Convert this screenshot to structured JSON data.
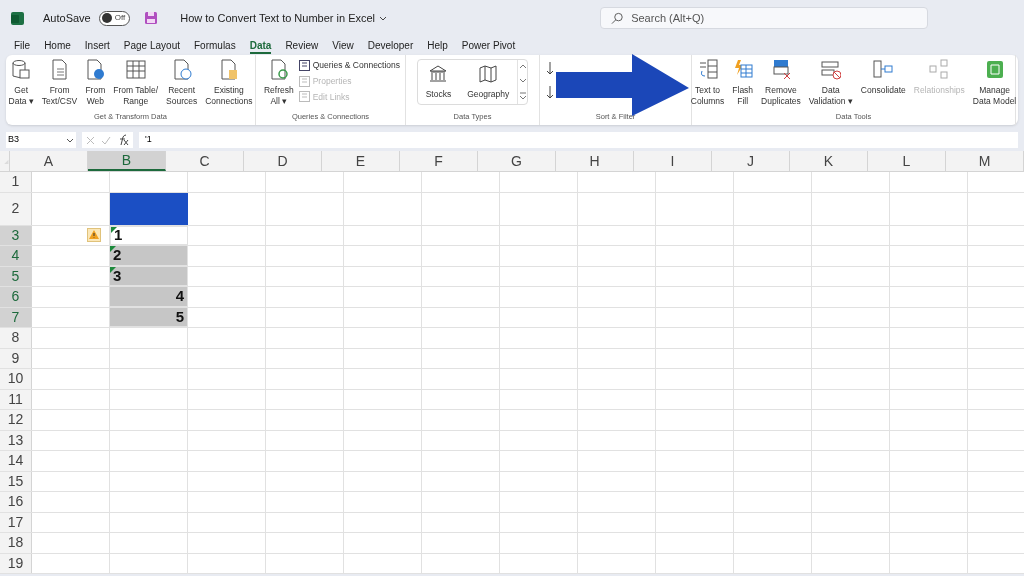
{
  "title_bar": {
    "autosave_label": "AutoSave",
    "autosave": {
      "on": false,
      "label": "Off"
    },
    "document_title": "How to Convert Text to Number in Excel",
    "search": {
      "placeholder": "Search (Alt+Q)"
    }
  },
  "tabs": [
    {
      "label": "File",
      "selected": false
    },
    {
      "label": "Home",
      "selected": false
    },
    {
      "label": "Insert",
      "selected": false
    },
    {
      "label": "Page Layout",
      "selected": false
    },
    {
      "label": "Formulas",
      "selected": false
    },
    {
      "label": "Data",
      "selected": true
    },
    {
      "label": "Review",
      "selected": false
    },
    {
      "label": "View",
      "selected": false
    },
    {
      "label": "Developer",
      "selected": false
    },
    {
      "label": "Help",
      "selected": false
    },
    {
      "label": "Power Pivot",
      "selected": false
    }
  ],
  "ribbon_groups": [
    {
      "label": "Get & Transform Data",
      "kind": "buttons",
      "buttons": [
        {
          "lines": [
            "Get",
            "Data ▾"
          ],
          "disabled": false
        },
        {
          "lines": [
            "From",
            "Text/CSV"
          ],
          "disabled": false
        },
        {
          "lines": [
            "From",
            "Web"
          ],
          "disabled": false
        },
        {
          "lines": [
            "From Table/",
            "Range"
          ],
          "disabled": false
        },
        {
          "lines": [
            "Recent",
            "Sources"
          ],
          "disabled": false
        },
        {
          "lines": [
            "Existing",
            "Connections"
          ],
          "disabled": false
        }
      ]
    },
    {
      "label": "Queries & Connections",
      "kind": "queries",
      "buttons": [
        {
          "lines": [
            "Refresh",
            "All ▾"
          ],
          "disabled": false
        }
      ],
      "small": [
        {
          "label": "Queries & Connections",
          "disabled": false
        },
        {
          "label": "Properties",
          "disabled": true
        },
        {
          "label": "Edit Links",
          "disabled": true
        }
      ]
    },
    {
      "label": "Data Types",
      "kind": "types",
      "buttons": [
        {
          "lines": [
            "Stocks"
          ]
        },
        {
          "lines": [
            "Geography"
          ]
        }
      ]
    },
    {
      "label": "Sort & Filter",
      "kind": "sort"
    },
    {
      "label": "Data Tools",
      "kind": "buttons",
      "buttons": [
        {
          "lines": [
            "Text to",
            "Columns"
          ],
          "disabled": false
        },
        {
          "lines": [
            "Flash",
            "Fill"
          ],
          "disabled": false
        },
        {
          "lines": [
            "Remove",
            "Duplicates"
          ],
          "disabled": false
        },
        {
          "lines": [
            "Data",
            "Validation ▾"
          ],
          "disabled": false
        },
        {
          "lines": [
            "Consolidate"
          ],
          "disabled": false
        },
        {
          "lines": [
            "Relationships"
          ],
          "disabled": true
        },
        {
          "lines": [
            "Manage",
            "Data Model"
          ],
          "disabled": false
        }
      ]
    }
  ],
  "formula_bar": {
    "name_box": "B3",
    "formula": "'1"
  },
  "columns": [
    {
      "label": "A",
      "selected": false
    },
    {
      "label": "B",
      "selected": true
    },
    {
      "label": "C",
      "selected": false
    },
    {
      "label": "D",
      "selected": false
    },
    {
      "label": "E",
      "selected": false
    },
    {
      "label": "F",
      "selected": false
    },
    {
      "label": "G",
      "selected": false
    },
    {
      "label": "H",
      "selected": false
    },
    {
      "label": "I",
      "selected": false
    },
    {
      "label": "J",
      "selected": false
    },
    {
      "label": "K",
      "selected": false
    },
    {
      "label": "L",
      "selected": false
    },
    {
      "label": "M",
      "selected": false
    }
  ],
  "rows": [
    {
      "header": "1",
      "selected": false
    },
    {
      "header": "2",
      "selected": false,
      "column_b": {
        "kind": "banner"
      }
    },
    {
      "header": "3",
      "selected": true,
      "warning": true,
      "column_b": {
        "kind": "text",
        "value": "1",
        "selected": true
      }
    },
    {
      "header": "4",
      "selected": true,
      "column_b": {
        "kind": "text",
        "value": "2",
        "selected": false
      }
    },
    {
      "header": "5",
      "selected": true,
      "column_b": {
        "kind": "text",
        "value": "3",
        "selected": false
      }
    },
    {
      "header": "6",
      "selected": true,
      "column_b": {
        "kind": "number",
        "value": "4",
        "selected": false
      }
    },
    {
      "header": "7",
      "selected": true,
      "column_b": {
        "kind": "number",
        "value": "5",
        "selected": false
      }
    },
    {
      "header": "8",
      "selected": false
    },
    {
      "header": "9",
      "selected": false
    },
    {
      "header": "10",
      "selected": false
    },
    {
      "header": "11",
      "selected": false
    },
    {
      "header": "12",
      "selected": false
    },
    {
      "header": "13",
      "selected": false
    },
    {
      "header": "14",
      "selected": false
    },
    {
      "header": "15",
      "selected": false
    },
    {
      "header": "16",
      "selected": false
    },
    {
      "header": "17",
      "selected": false
    },
    {
      "header": "18",
      "selected": false
    },
    {
      "header": "19",
      "selected": false
    }
  ],
  "callout": {
    "kind": "arrow"
  }
}
